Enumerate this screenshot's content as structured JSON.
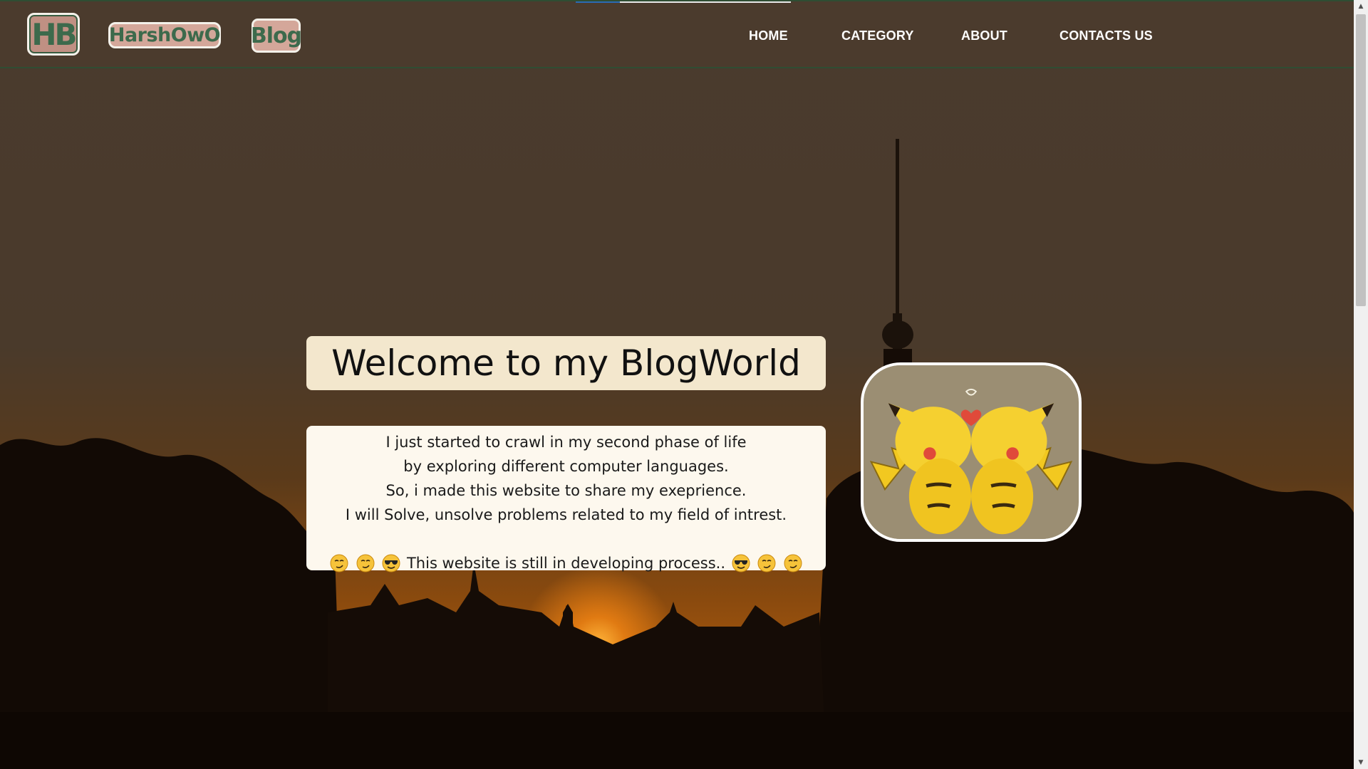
{
  "header": {
    "logo_initials": "HB",
    "logo_name": "HarshOwO",
    "logo_blog": "Blog",
    "nav": [
      {
        "label": "HOME"
      },
      {
        "label": "CATEGORY"
      },
      {
        "label": "ABOUT"
      },
      {
        "label": "CONTACTS US"
      }
    ]
  },
  "hero": {
    "title": "Welcome to my BlogWorld",
    "lines": [
      "I just started to crawl in my second phase of life",
      "by exploring different computer languages.",
      "So, i made this website to share my exeprience.",
      "I will Solve, unsolve problems related to my field of intrest."
    ],
    "status_text": "This website is still in developing process..",
    "status_emojis_left": [
      "smirk-emoji",
      "smirk-emoji",
      "sunglasses-emoji"
    ],
    "status_emojis_right": [
      "sunglasses-emoji",
      "smirk-emoji",
      "smirk-emoji"
    ]
  },
  "colors": {
    "topbar": "#4b3b2d",
    "logo_green": "#3d6a4c",
    "logo_pink": "#d4a79a",
    "welcome_bg": "#f3e7cd",
    "intro_bg": "#fdf8ee"
  }
}
